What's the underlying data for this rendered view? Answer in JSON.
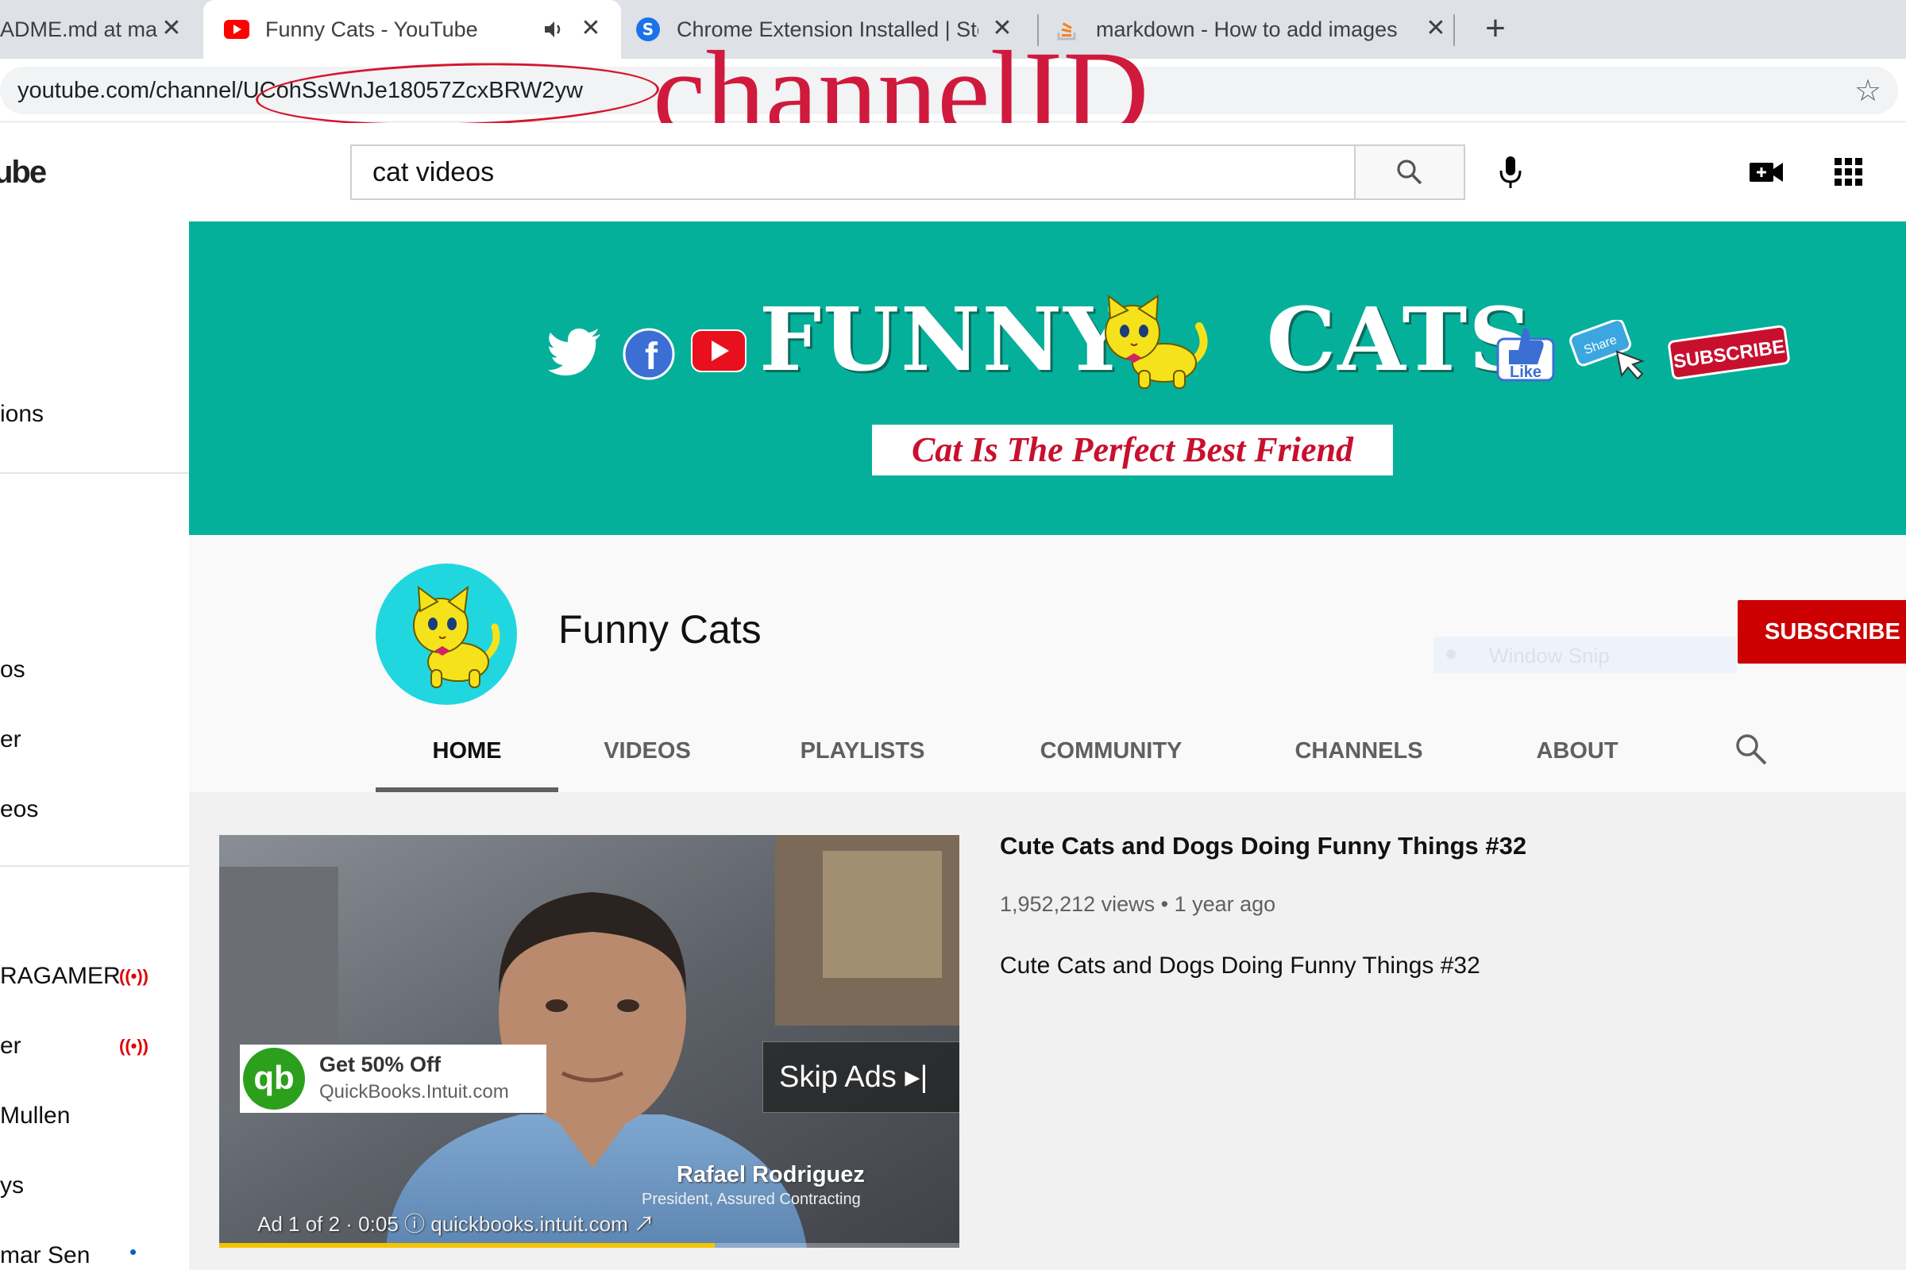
{
  "browser": {
    "tabs": [
      {
        "title": "ADME.md at ma",
        "active": false
      },
      {
        "title": "Funny Cats - YouTube",
        "active": true,
        "audio": true
      },
      {
        "title": "Chrome Extension Installed | Ster",
        "active": false
      },
      {
        "title": "markdown - How to add images",
        "active": false
      }
    ],
    "new_tab_label": "+",
    "close_glyph": "✕",
    "url_prefix": "youtube.com/channel/",
    "url_id": "UCohSsWnJe18057ZcxBRW2yw",
    "annotation": "channelID",
    "annotation_color": "#cf1a3d"
  },
  "masthead": {
    "logo_fragment": "ube",
    "search_value": "cat videos",
    "icons": [
      "search-icon",
      "mic-icon",
      "create-video-icon",
      "apps-grid-icon"
    ]
  },
  "sidebar": {
    "items": [
      {
        "label": "ions"
      },
      {
        "label": "os"
      },
      {
        "label": "er"
      },
      {
        "label": "eos"
      },
      {
        "label": "RAGAMER",
        "live": true
      },
      {
        "label": "er",
        "live": true
      },
      {
        "label": "Mullen"
      },
      {
        "label": "ys"
      },
      {
        "label": "mar Sen",
        "new": true
      }
    ],
    "live_glyph": "((•))",
    "new_glyph": "•"
  },
  "banner": {
    "title_left": "FUNNY",
    "title_right": "CATS",
    "tagline": "Cat Is The Perfect Best Friend",
    "like_label": "Like",
    "share_label": "Share",
    "subscribe_label": "SUBSCRIBE",
    "background": "#05b09a"
  },
  "channel": {
    "name": "Funny Cats",
    "subscribe_label": "SUBSCRIBE",
    "window_snip": "Window Snip",
    "tabs": [
      "HOME",
      "VIDEOS",
      "PLAYLISTS",
      "COMMUNITY",
      "CHANNELS",
      "ABOUT"
    ],
    "active_tab": "HOME"
  },
  "featured": {
    "title": "Cute Cats and Dogs Doing Funny Things #32",
    "meta": "1,952,212 views • 1 year ago",
    "description": "Cute Cats and Dogs Doing Funny Things #32",
    "ad": {
      "offer": "Get 50% Off",
      "domain": "QuickBooks.Intuit.com",
      "logo_text": "qb",
      "skip_label": "Skip Ads ▸|",
      "presenter_name": "Rafael Rodriguez",
      "presenter_title": "President, Assured Contracting",
      "info": "Ad 1 of 2 · 0:05 ⓘ quickbooks.intuit.com ↗",
      "progress": 0.67
    }
  }
}
